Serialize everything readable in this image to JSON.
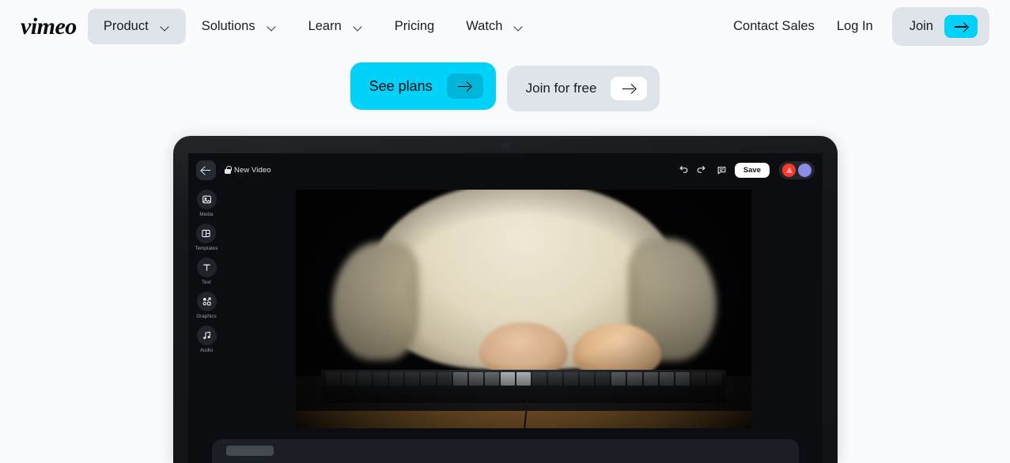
{
  "page": {
    "background_color": "#fafbfd"
  },
  "header": {
    "logo_text": "vimeo",
    "nav_items": [
      {
        "label": "Product",
        "has_chevron": true,
        "active": true,
        "icon": "chevron-down-icon"
      },
      {
        "label": "Solutions",
        "has_chevron": true,
        "active": false,
        "icon": "chevron-down-icon"
      },
      {
        "label": "Learn",
        "has_chevron": true,
        "active": false,
        "icon": "chevron-down-icon"
      },
      {
        "label": "Pricing",
        "has_chevron": false,
        "active": false,
        "icon": ""
      },
      {
        "label": "Watch",
        "has_chevron": true,
        "active": false,
        "icon": "chevron-down-icon"
      }
    ],
    "contact_sales_label": "Contact Sales",
    "log_in_label": "Log In",
    "join_label": "Join",
    "join_arrow_icon": "arrow-right-icon",
    "accent_color": "#00d2f9",
    "pill_color": "#dfe3ea"
  },
  "cta": {
    "primary": {
      "label": "See plans",
      "icon": "arrow-right-icon",
      "background_color": "#00d2f9",
      "chip_color": "#01b5d8"
    },
    "secondary": {
      "label": "Join for free",
      "icon": "arrow-right-icon",
      "background_color": "#dfe3ea",
      "chip_color": "#ffffff"
    }
  },
  "laptop": {
    "camera_icon": "camera-dot-icon",
    "editor": {
      "back_icon": "arrow-left-icon",
      "lock_icon": "lock-icon",
      "document_title": "New Video",
      "undo_icon": "undo-icon",
      "redo_icon": "redo-icon",
      "comment_icon": "comment-bubble-icon",
      "save_label": "Save",
      "avatars": [
        {
          "name": "avatar-red",
          "color": "#fb3b25",
          "glyph": "triangle-icon"
        },
        {
          "name": "avatar-purple",
          "color": "#8b8ce8",
          "glyph": ""
        }
      ],
      "sidebar_items": [
        {
          "label": "Media",
          "icon": "image-icon"
        },
        {
          "label": "Templates",
          "icon": "layout-icon"
        },
        {
          "label": "Text",
          "icon": "text-t-icon"
        },
        {
          "label": "Graphics",
          "icon": "shapes-icon"
        },
        {
          "label": "Audio",
          "icon": "music-note-icon"
        }
      ],
      "canvas": {
        "description": "Person in cream shirt typing on a black mechanical keyboard at a wooden desk, dark background"
      },
      "drag_handle_icon": "drag-handle-icon",
      "timeline_panel_label": ""
    }
  }
}
